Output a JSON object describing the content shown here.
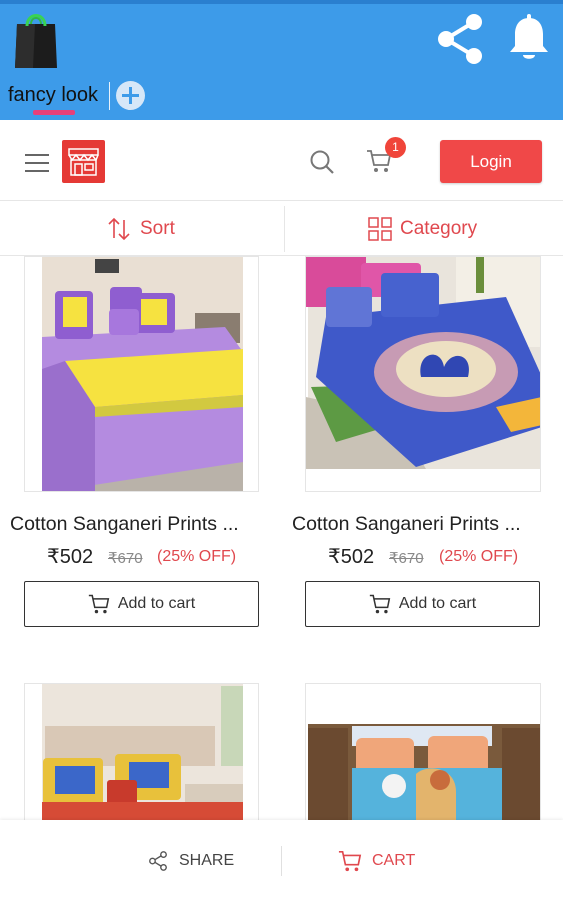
{
  "app": {
    "tab_title": "fancy look"
  },
  "header": {
    "cart_count": "1",
    "login_label": "Login"
  },
  "filters": {
    "sort_label": "Sort",
    "category_label": "Category"
  },
  "products": [
    {
      "title": "Cotton Sanganeri Prints ...",
      "price": "₹502",
      "old_price": "₹670",
      "discount": "(25% OFF)",
      "cta": "Add to cart"
    },
    {
      "title": "Cotton Sanganeri Prints ...",
      "price": "₹502",
      "old_price": "₹670",
      "discount": "(25% OFF)",
      "cta": "Add to cart"
    }
  ],
  "bottom_bar": {
    "share_label": "SHARE",
    "cart_label": "CART"
  },
  "colors": {
    "topbar_blue": "#3d9be9",
    "accent_red": "#e0484e",
    "login_red": "#f04848",
    "tab_indicator": "#e8407a"
  },
  "icons": [
    "shopping-bag-icon",
    "share-icon",
    "bell-icon",
    "plus-icon",
    "menu-icon",
    "store-icon",
    "search-icon",
    "cart-icon",
    "sort-icon",
    "grid-icon"
  ]
}
